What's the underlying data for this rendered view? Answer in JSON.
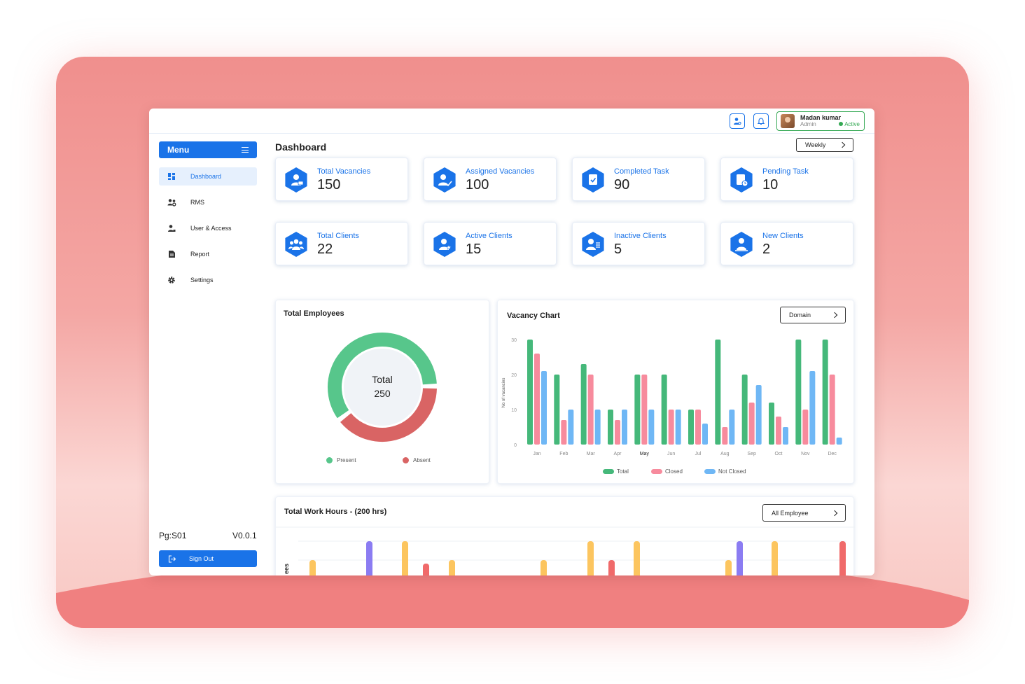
{
  "topbar": {
    "user": {
      "name": "Madan kumar",
      "role": "Admin",
      "status": "Active"
    }
  },
  "sidebar": {
    "menu_label": "Menu",
    "items": [
      {
        "label": "Dashboard",
        "icon": "dashboard-icon",
        "active": true
      },
      {
        "label": "RMS",
        "icon": "users-icon",
        "active": false
      },
      {
        "label": "User & Access",
        "icon": "user-access-icon",
        "active": false
      },
      {
        "label": "Report",
        "icon": "report-icon",
        "active": false
      },
      {
        "label": "Settings",
        "icon": "gear-icon",
        "active": false
      }
    ],
    "page_code": "Pg:S01",
    "version": "V0.0.1",
    "signout_label": "Sign Out"
  },
  "main": {
    "title": "Dashboard",
    "period_filter": "Weekly",
    "stats": [
      {
        "label": "Total Vacancies",
        "value": "150",
        "icon": "vacancy-icon"
      },
      {
        "label": "Assigned Vacancies",
        "value": "100",
        "icon": "assigned-icon"
      },
      {
        "label": "Completed Task",
        "value": "90",
        "icon": "completed-task-icon"
      },
      {
        "label": "Pending Task",
        "value": "10",
        "icon": "pending-task-icon"
      },
      {
        "label": "Total Clients",
        "value": "22",
        "icon": "clients-icon"
      },
      {
        "label": "Active Clients",
        "value": "15",
        "icon": "active-clients-icon"
      },
      {
        "label": "Inactive Clients",
        "value": "5",
        "icon": "inactive-clients-icon"
      },
      {
        "label": "New Clients",
        "value": "2",
        "icon": "new-clients-icon"
      }
    ]
  },
  "colors": {
    "primary": "#1a73e8",
    "present": "#57c68b",
    "absent": "#d96464",
    "total": "#45b87a",
    "closed": "#f78b9d",
    "not_closed": "#6fb7f5",
    "hours_yellow": "#fcc55f",
    "hours_purple": "#8b7cf2",
    "hours_red": "#f06a6a"
  },
  "chart_data": [
    {
      "type": "pie",
      "title": "Total Employees",
      "center_label": "Total",
      "center_value": "250",
      "categories": [
        "Present",
        "Absent"
      ],
      "values": [
        150,
        100
      ]
    },
    {
      "type": "bar",
      "title": "Vacancy Chart",
      "filter": "Domain",
      "ylabel": "No of vacancies",
      "ylim": [
        0,
        30
      ],
      "yticks": [
        "0",
        "10",
        "20",
        "30"
      ],
      "categories": [
        "Jan",
        "Feb",
        "Mar",
        "Apr",
        "May",
        "Jun",
        "Jul",
        "Aug",
        "Sep",
        "Oct",
        "Nov",
        "Dec"
      ],
      "series": [
        {
          "name": "Total",
          "values": [
            30,
            20,
            23,
            10,
            20,
            20,
            10,
            30,
            20,
            12,
            30,
            30
          ]
        },
        {
          "name": "Closed",
          "values": [
            26,
            7,
            20,
            7,
            20,
            10,
            10,
            5,
            12,
            8,
            10,
            20
          ]
        },
        {
          "name": "Not Closed",
          "values": [
            21,
            10,
            10,
            10,
            10,
            10,
            6,
            10,
            17,
            5,
            21,
            2
          ]
        }
      ]
    },
    {
      "type": "bar",
      "title": "Total Work Hours - (200 hrs)",
      "filter": "All Employee",
      "ylabel": "ees"
    }
  ]
}
